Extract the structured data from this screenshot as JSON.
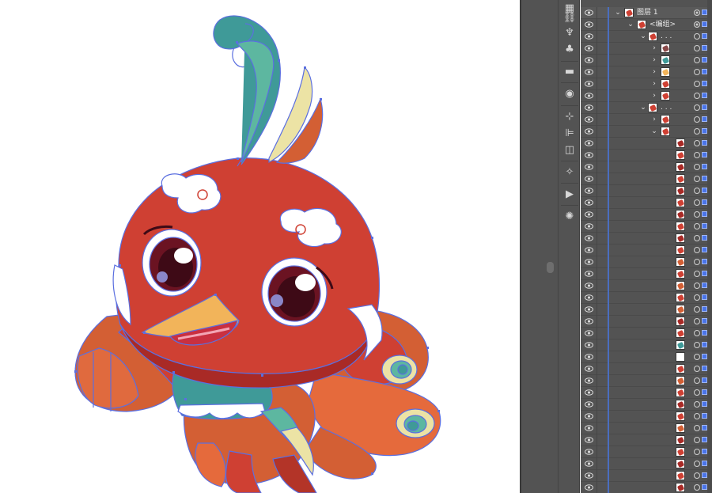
{
  "canvas": {
    "artwork": "phoenix-chick-cartoon",
    "colors": {
      "body_red": "#cf4033",
      "dark_red": "#a92a26",
      "orange": "#d35f34",
      "teal": "#3f9a98",
      "mint": "#5db7a0",
      "yellow_beak": "#f2b45a",
      "cream": "#ece3a5",
      "eye_dark": "#6b1322",
      "path_outline": "#5b6fe0"
    }
  },
  "tools": [
    {
      "icon": "libraries-icon",
      "glyph": "▦"
    },
    {
      "icon": "links-icon",
      "glyph": "⛓"
    },
    {
      "icon": "puppet-warp-icon",
      "glyph": "♆"
    },
    {
      "icon": "symbols-icon",
      "glyph": "♣"
    },
    {
      "icon": "gradient-icon",
      "glyph": "▬"
    },
    {
      "icon": "appearance-icon",
      "glyph": "◉"
    },
    {
      "icon": "transform-icon",
      "glyph": "⊹"
    },
    {
      "icon": "align-icon",
      "glyph": "⊫"
    },
    {
      "icon": "pathfinder-icon",
      "glyph": "◫"
    },
    {
      "icon": "magic-wand-icon",
      "glyph": "✧"
    },
    {
      "icon": "actions-icon",
      "glyph": "▶"
    },
    {
      "icon": "color-guide-icon",
      "glyph": "✺"
    }
  ],
  "layers": {
    "layer_name": "图层 1",
    "group_name": "<编组>",
    "rows": [
      {
        "indent": 0,
        "caret": "v",
        "label": "图层 1",
        "thumb": "#cf4033",
        "target": "filled"
      },
      {
        "indent": 1,
        "caret": "v",
        "label": "<编组>",
        "thumb": "#cf4033",
        "target": "filled"
      },
      {
        "indent": 2,
        "caret": "v",
        "label": ". . .",
        "thumb": "#cf4033",
        "target": "empty"
      },
      {
        "indent": 3,
        "caret": ">",
        "label": "",
        "thumb": "#8a4a4a",
        "target": "empty"
      },
      {
        "indent": 3,
        "caret": ">",
        "label": "",
        "thumb": "#3f9a98",
        "target": "empty"
      },
      {
        "indent": 3,
        "caret": ">",
        "label": "",
        "thumb": "#f2b45a",
        "target": "empty"
      },
      {
        "indent": 3,
        "caret": ">",
        "label": "",
        "thumb": "#cf4033",
        "target": "empty"
      },
      {
        "indent": 3,
        "caret": ">",
        "label": "",
        "thumb": "#cf4033",
        "target": "empty"
      },
      {
        "indent": 2,
        "caret": "v",
        "label": ". . .",
        "thumb": "#cf4033",
        "target": "empty"
      },
      {
        "indent": 3,
        "caret": ">",
        "label": "",
        "thumb": "#cf4033",
        "target": "empty"
      },
      {
        "indent": 3,
        "caret": "v",
        "label": "",
        "thumb": "#cf4033",
        "target": "empty"
      },
      {
        "indent": 4,
        "caret": "",
        "label": "",
        "thumb": "#a92a26",
        "target": "empty"
      },
      {
        "indent": 4,
        "caret": "",
        "label": "",
        "thumb": "#cf4033",
        "target": "empty"
      },
      {
        "indent": 4,
        "caret": "",
        "label": "",
        "thumb": "#a92a26",
        "target": "empty"
      },
      {
        "indent": 4,
        "caret": "",
        "label": "",
        "thumb": "#cf4033",
        "target": "empty"
      },
      {
        "indent": 4,
        "caret": "",
        "label": "",
        "thumb": "#a92a26",
        "target": "empty"
      },
      {
        "indent": 4,
        "caret": "",
        "label": "",
        "thumb": "#cf4033",
        "target": "empty"
      },
      {
        "indent": 4,
        "caret": "",
        "label": "",
        "thumb": "#a92a26",
        "target": "empty"
      },
      {
        "indent": 4,
        "caret": "",
        "label": "",
        "thumb": "#cf4033",
        "target": "empty"
      },
      {
        "indent": 4,
        "caret": "",
        "label": "",
        "thumb": "#a92a26",
        "target": "empty"
      },
      {
        "indent": 4,
        "caret": "",
        "label": "",
        "thumb": "#cf4033",
        "target": "empty"
      },
      {
        "indent": 4,
        "caret": "",
        "label": "",
        "thumb": "#d35f34",
        "target": "empty"
      },
      {
        "indent": 4,
        "caret": "",
        "label": "",
        "thumb": "#cf4033",
        "target": "empty"
      },
      {
        "indent": 4,
        "caret": "",
        "label": "",
        "thumb": "#d35f34",
        "target": "empty"
      },
      {
        "indent": 4,
        "caret": "",
        "label": "",
        "thumb": "#cf4033",
        "target": "empty"
      },
      {
        "indent": 4,
        "caret": "",
        "label": "",
        "thumb": "#d35f34",
        "target": "empty"
      },
      {
        "indent": 4,
        "caret": "",
        "label": "",
        "thumb": "#a92a26",
        "target": "empty"
      },
      {
        "indent": 4,
        "caret": "",
        "label": "",
        "thumb": "#cf4033",
        "target": "empty"
      },
      {
        "indent": 4,
        "caret": "",
        "label": "",
        "thumb": "#3f9a98",
        "target": "empty"
      },
      {
        "indent": 4,
        "caret": "",
        "label": "",
        "thumb": "#ffffff",
        "target": "empty"
      },
      {
        "indent": 4,
        "caret": "",
        "label": "",
        "thumb": "#cf4033",
        "target": "empty"
      },
      {
        "indent": 4,
        "caret": "",
        "label": "",
        "thumb": "#d35f34",
        "target": "empty"
      },
      {
        "indent": 4,
        "caret": "",
        "label": "",
        "thumb": "#cf4033",
        "target": "empty"
      },
      {
        "indent": 4,
        "caret": "",
        "label": "",
        "thumb": "#a92a26",
        "target": "empty"
      },
      {
        "indent": 4,
        "caret": "",
        "label": "",
        "thumb": "#cf4033",
        "target": "empty"
      },
      {
        "indent": 4,
        "caret": "",
        "label": "",
        "thumb": "#d35f34",
        "target": "empty"
      },
      {
        "indent": 4,
        "caret": "",
        "label": "",
        "thumb": "#a92a26",
        "target": "empty"
      },
      {
        "indent": 4,
        "caret": "",
        "label": "",
        "thumb": "#cf4033",
        "target": "empty"
      },
      {
        "indent": 4,
        "caret": "",
        "label": "",
        "thumb": "#a92a26",
        "target": "empty"
      },
      {
        "indent": 4,
        "caret": "",
        "label": "",
        "thumb": "#cf4033",
        "target": "empty"
      },
      {
        "indent": 4,
        "caret": "",
        "label": "",
        "thumb": "#a92a26",
        "target": "empty"
      }
    ]
  }
}
